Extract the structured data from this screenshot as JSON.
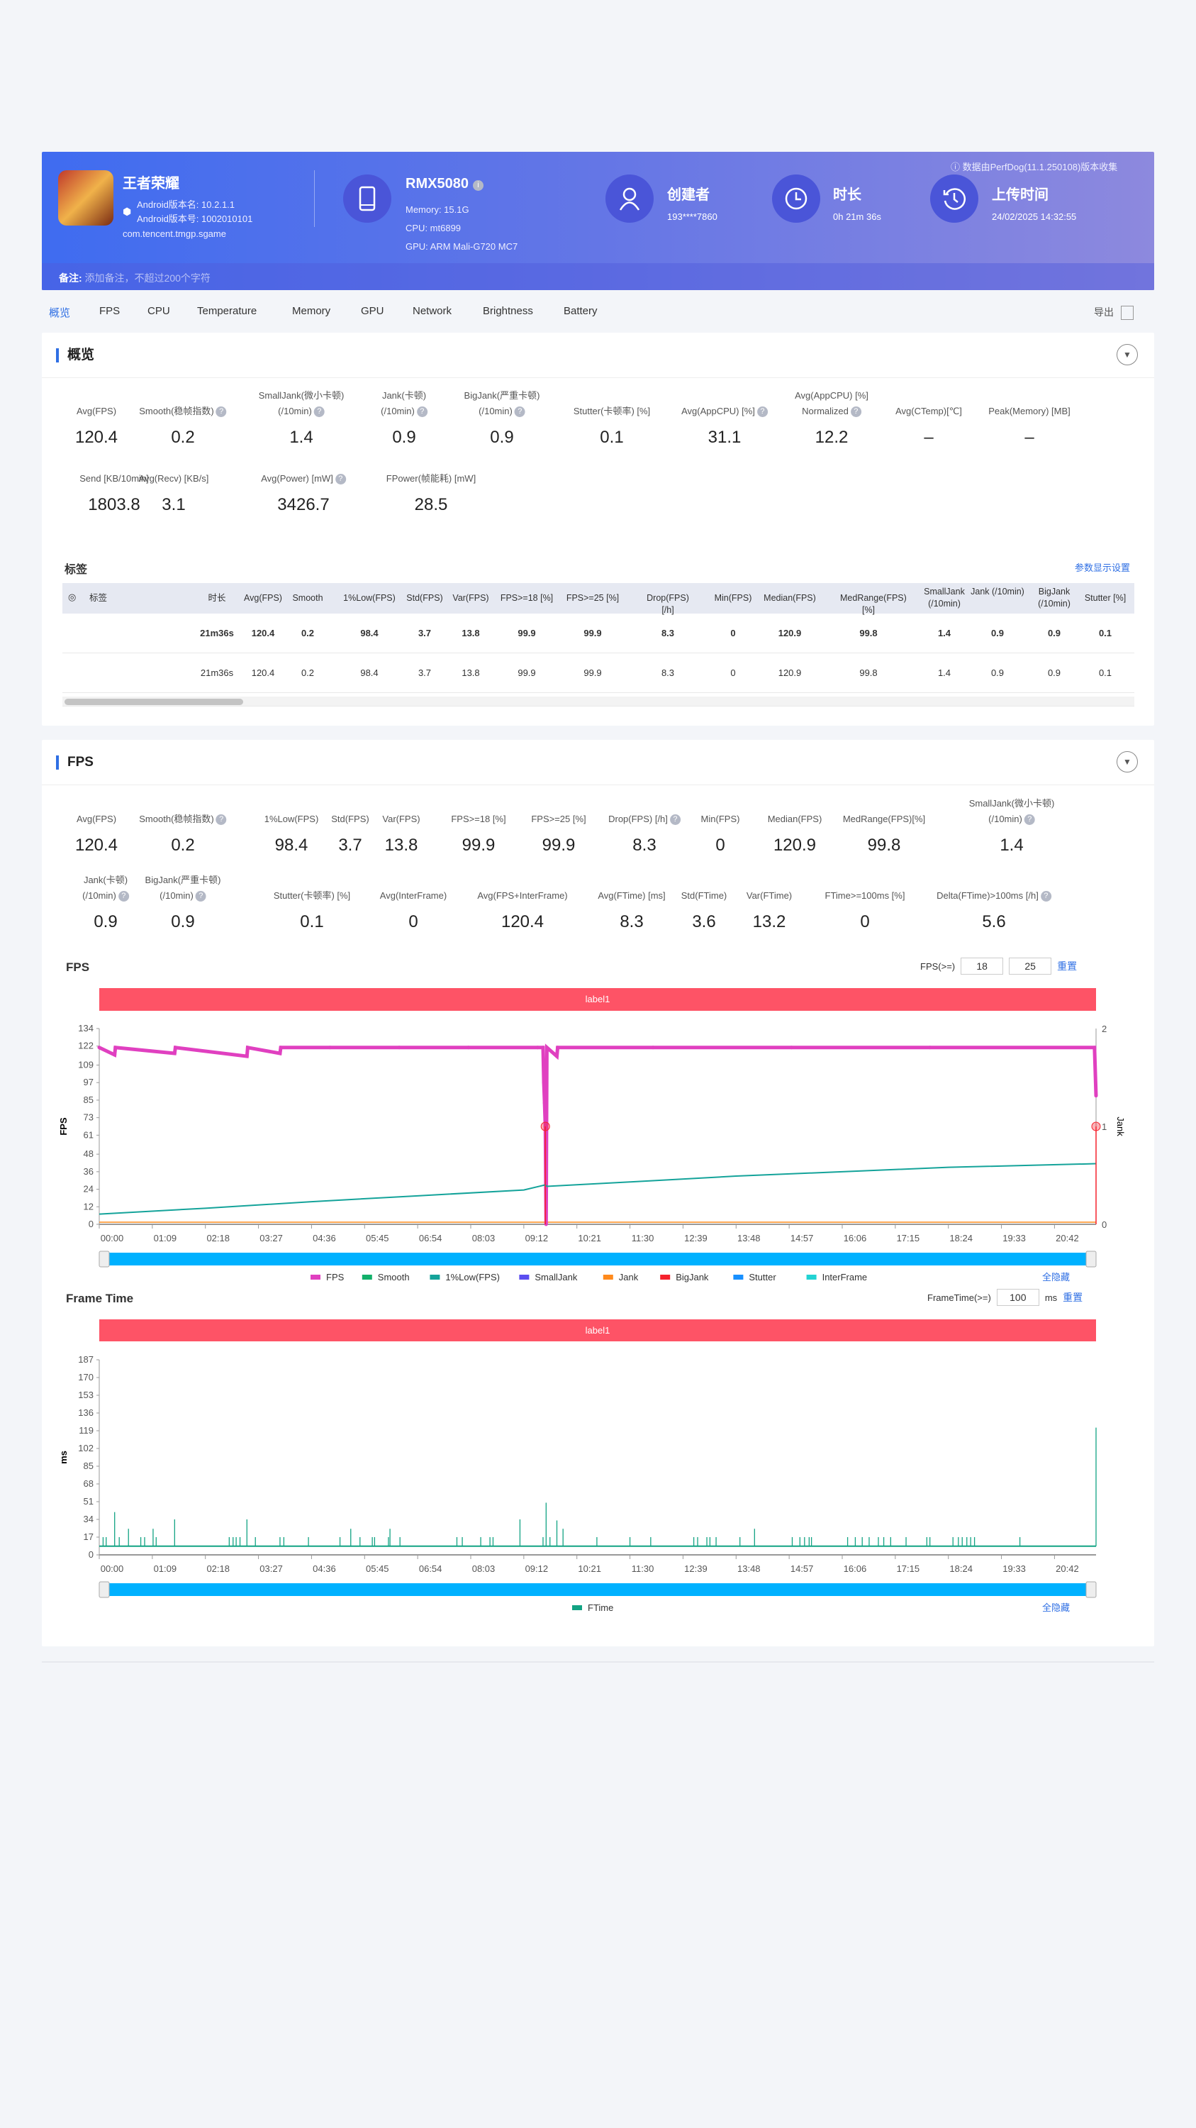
{
  "header": {
    "app_name": "王者荣耀",
    "android_version_name": "Android版本名: 10.2.1.1",
    "android_version_code": "Android版本号: 1002010101",
    "package": "com.tencent.tmgp.sgame",
    "device": "RMX5080",
    "memory": "Memory: 15.1G",
    "cpu": "CPU: mt6899",
    "gpu": "GPU: ARM Mali-G720 MC7",
    "creator_label": "创建者",
    "creator": "193****7860",
    "duration_label": "时长",
    "duration": "0h 21m 36s",
    "upload_label": "上传时间",
    "upload_time": "24/02/2025 14:32:55",
    "collected_by": "数据由PerfDog(11.1.250108)版本收集",
    "note_label": "备注:",
    "note_placeholder": "添加备注，不超过200个字符"
  },
  "tabs": [
    "概览",
    "FPS",
    "CPU",
    "Temperature",
    "Memory",
    "GPU",
    "Network",
    "Brightness",
    "Battery"
  ],
  "active_tab": 0,
  "export_label": "导出",
  "overview": {
    "title": "概览",
    "row1": [
      {
        "label": [
          "Avg(FPS)"
        ],
        "value": "120.4"
      },
      {
        "label": [
          "Smooth(稳帧指数)"
        ],
        "help": true,
        "value": "0.2"
      },
      {
        "label": [
          "SmallJank(微小卡顿)",
          "(/10min)"
        ],
        "help": true,
        "value": "1.4"
      },
      {
        "label": [
          "Jank(卡顿)",
          "(/10min)"
        ],
        "help": true,
        "value": "0.9"
      },
      {
        "label": [
          "BigJank(严重卡顿)",
          "(/10min)"
        ],
        "help": true,
        "value": "0.9"
      },
      {
        "label": [
          "Stutter(卡顿率) [%]"
        ],
        "value": "0.1"
      },
      {
        "label": [
          "Avg(AppCPU) [%]"
        ],
        "help": true,
        "value": "31.1"
      },
      {
        "label": [
          "Avg(AppCPU) [%]",
          "Normalized"
        ],
        "help": true,
        "value": "12.2"
      },
      {
        "label": [
          "Avg(CTemp)[℃]"
        ],
        "value": "–"
      },
      {
        "label": [
          "Peak(Memory) [MB]"
        ],
        "value": "–"
      }
    ],
    "row2": [
      {
        "label": [
          "Send [KB/10min]"
        ],
        "value": "1803.8"
      },
      {
        "label": [
          "Avg(Recv) [KB/s]"
        ],
        "value": "3.1"
      },
      {
        "label": [
          "Avg(Power) [mW]"
        ],
        "help": true,
        "value": "3426.7"
      },
      {
        "label": [
          "FPower(帧能耗) [mW]"
        ],
        "value": "28.5"
      }
    ],
    "tags_title": "标签",
    "param_settings": "参数显示设置",
    "table": {
      "columns": [
        "标签",
        "时长",
        "Avg(FPS)",
        "Smooth",
        "1%Low(FPS)",
        "Std(FPS)",
        "Var(FPS)",
        "FPS>=18 [%]",
        "FPS>=25 [%]",
        "Drop(FPS) [/h]",
        "Min(FPS)",
        "Median(FPS)",
        "MedRange(FPS)[%]",
        "SmallJank (/10min)",
        "Jank (/10min)",
        "BigJank (/10min)",
        "Stutter [%]"
      ],
      "rows": [
        [
          "",
          "21m36s",
          "120.4",
          "0.2",
          "98.4",
          "3.7",
          "13.8",
          "99.9",
          "99.9",
          "8.3",
          "0",
          "120.9",
          "99.8",
          "1.4",
          "0.9",
          "0.9",
          "0.1"
        ],
        [
          "",
          "21m36s",
          "120.4",
          "0.2",
          "98.4",
          "3.7",
          "13.8",
          "99.9",
          "99.9",
          "8.3",
          "0",
          "120.9",
          "99.8",
          "1.4",
          "0.9",
          "0.9",
          "0.1"
        ]
      ]
    }
  },
  "fps_section": {
    "title": "FPS",
    "row1": [
      {
        "label": [
          "Avg(FPS)"
        ],
        "value": "120.4"
      },
      {
        "label": [
          "Smooth(稳帧指数)"
        ],
        "help": true,
        "value": "0.2"
      },
      {
        "label": [
          "1%Low(FPS)"
        ],
        "value": "98.4"
      },
      {
        "label": [
          "Std(FPS)"
        ],
        "value": "3.7"
      },
      {
        "label": [
          "Var(FPS)"
        ],
        "value": "13.8"
      },
      {
        "label": [
          "FPS>=18 [%]"
        ],
        "value": "99.9"
      },
      {
        "label": [
          "FPS>=25 [%]"
        ],
        "value": "99.9"
      },
      {
        "label": [
          "Drop(FPS) [/h]"
        ],
        "help": true,
        "value": "8.3"
      },
      {
        "label": [
          "Min(FPS)"
        ],
        "value": "0"
      },
      {
        "label": [
          "Median(FPS)"
        ],
        "value": "120.9"
      },
      {
        "label": [
          "MedRange(FPS)[%]"
        ],
        "value": "99.8"
      },
      {
        "label": [
          "SmallJank(微小卡顿)",
          "(/10min)"
        ],
        "help": true,
        "value": "1.4"
      }
    ],
    "row2": [
      {
        "label": [
          "Jank(卡顿)",
          "(/10min)"
        ],
        "help": true,
        "value": "0.9"
      },
      {
        "label": [
          "BigJank(严重卡顿)",
          "(/10min)"
        ],
        "help": true,
        "value": "0.9"
      },
      {
        "label": [
          "Stutter(卡顿率) [%]"
        ],
        "value": "0.1"
      },
      {
        "label": [
          "Avg(InterFrame)"
        ],
        "value": "0"
      },
      {
        "label": [
          "Avg(FPS+InterFrame)"
        ],
        "value": "120.4"
      },
      {
        "label": [
          "Avg(FTime) [ms]"
        ],
        "value": "8.3"
      },
      {
        "label": [
          "Std(FTime)"
        ],
        "value": "3.6"
      },
      {
        "label": [
          "Var(FTime)"
        ],
        "value": "13.2"
      },
      {
        "label": [
          "FTime>=100ms [%]"
        ],
        "value": "0"
      },
      {
        "label": [
          "Delta(FTime)>100ms [/h]"
        ],
        "help": true,
        "value": "5.6"
      }
    ],
    "fps_threshold_label": "FPS(>=)",
    "fps_threshold_1": "18",
    "fps_threshold_2": "25",
    "reset": "重置",
    "ftime_threshold_label": "FrameTime(>=)",
    "ftime_threshold": "100",
    "ftime_unit": "ms",
    "hide_all": "全隐藏",
    "watermark": "PerfDog"
  },
  "chart_data": [
    {
      "type": "line",
      "title": "FPS",
      "label_band": "label1",
      "ylabel": "FPS",
      "y2label": "Jank",
      "ylim": [
        0,
        134
      ],
      "yticks": [
        0,
        12,
        24,
        36,
        48,
        61,
        73,
        85,
        97,
        109,
        122,
        134
      ],
      "y2lim": [
        0,
        2
      ],
      "y2ticks": [
        0,
        1,
        2
      ],
      "xlim": [
        "00:00",
        "21:36"
      ],
      "xticks": [
        "00:00",
        "01:09",
        "02:18",
        "03:27",
        "04:36",
        "05:45",
        "06:54",
        "08:03",
        "09:12",
        "10:21",
        "11:30",
        "12:39",
        "13:48",
        "14:57",
        "16:06",
        "17:15",
        "18:24",
        "19:33",
        "20:42"
      ],
      "legend": [
        {
          "name": "FPS",
          "color": "#e040c0"
        },
        {
          "name": "Smooth",
          "color": "#12b06a"
        },
        {
          "name": "1%Low(FPS)",
          "color": "#14a39a"
        },
        {
          "name": "SmallJank",
          "color": "#5b4ef0"
        },
        {
          "name": "Jank",
          "color": "#ff8a1c"
        },
        {
          "name": "BigJank",
          "color": "#f5222d"
        },
        {
          "name": "Stutter",
          "color": "#1890ff"
        },
        {
          "name": "InterFrame",
          "color": "#22d3d3"
        }
      ],
      "series": [
        {
          "name": "FPS",
          "points": [
            [
              "00:00",
              121
            ],
            [
              "00:20",
              116
            ],
            [
              "00:21",
              121
            ],
            [
              "01:38",
              117
            ],
            [
              "01:39",
              121
            ],
            [
              "03:12",
              115
            ],
            [
              "03:13",
              121
            ],
            [
              "03:55",
              117
            ],
            [
              "03:56",
              121
            ],
            [
              "05:00",
              121
            ],
            [
              "06:30",
              121
            ],
            [
              "08:00",
              121
            ],
            [
              "09:30",
              121
            ],
            [
              "09:37",
              121
            ],
            [
              "09:38",
              97
            ],
            [
              "09:39",
              83
            ],
            [
              "09:40",
              67
            ],
            [
              "09:41",
              0
            ],
            [
              "09:42",
              121
            ],
            [
              "09:55",
              115
            ],
            [
              "09:56",
              121
            ],
            [
              "12:00",
              121
            ],
            [
              "15:00",
              121
            ],
            [
              "18:00",
              121
            ],
            [
              "21:34",
              121
            ],
            [
              "21:36",
              88
            ]
          ]
        },
        {
          "name": "1%Low(FPS)",
          "points": [
            [
              "00:00",
              7
            ],
            [
              "02:18",
              11
            ],
            [
              "04:36",
              15.5
            ],
            [
              "06:54",
              19.5
            ],
            [
              "09:12",
              23.5
            ],
            [
              "09:40",
              27
            ],
            [
              "09:42",
              26
            ],
            [
              "11:30",
              29
            ],
            [
              "13:48",
              33
            ],
            [
              "16:06",
              36
            ],
            [
              "18:24",
              39
            ],
            [
              "21:36",
              41.5
            ]
          ]
        },
        {
          "name": "BigJank",
          "axis": "right",
          "points": [
            [
              "09:40",
              1
            ],
            [
              "21:36",
              1
            ]
          ]
        }
      ]
    },
    {
      "type": "line",
      "title": "Frame Time",
      "label_band": "label1",
      "ylabel": "ms",
      "ylim": [
        0,
        187
      ],
      "yticks": [
        0,
        17,
        34,
        51,
        68,
        85,
        102,
        119,
        136,
        153,
        170,
        187
      ],
      "xlim": [
        "00:00",
        "21:36"
      ],
      "xticks": [
        "00:00",
        "01:09",
        "02:18",
        "03:27",
        "04:36",
        "05:45",
        "06:54",
        "08:03",
        "09:12",
        "10:21",
        "11:30",
        "12:39",
        "13:48",
        "14:57",
        "16:06",
        "17:15",
        "18:24",
        "19:33",
        "20:42"
      ],
      "legend": [
        {
          "name": "FTime",
          "color": "#12a383"
        }
      ],
      "series": [
        {
          "name": "FTime",
          "baseline": 8.3,
          "spikes": [
            [
              "00:05",
              17
            ],
            [
              "00:09",
              17
            ],
            [
              "00:20",
              41
            ],
            [
              "00:26",
              17
            ],
            [
              "00:38",
              25
            ],
            [
              "00:54",
              17
            ],
            [
              "00:59",
              17
            ],
            [
              "01:10",
              25
            ],
            [
              "01:14",
              17
            ],
            [
              "01:38",
              34
            ],
            [
              "02:49",
              17
            ],
            [
              "02:54",
              17
            ],
            [
              "02:58",
              17
            ],
            [
              "03:03",
              17
            ],
            [
              "03:12",
              34
            ],
            [
              "03:23",
              17
            ],
            [
              "03:55",
              17
            ],
            [
              "04:00",
              17
            ],
            [
              "04:32",
              17
            ],
            [
              "05:13",
              17
            ],
            [
              "05:27",
              25
            ],
            [
              "05:39",
              17
            ],
            [
              "05:55",
              17
            ],
            [
              "05:58",
              17
            ],
            [
              "06:16",
              17
            ],
            [
              "06:18",
              25
            ],
            [
              "06:31",
              17
            ],
            [
              "07:45",
              17
            ],
            [
              "07:52",
              17
            ],
            [
              "08:16",
              17
            ],
            [
              "08:28",
              17
            ],
            [
              "08:32",
              17
            ],
            [
              "09:07",
              34
            ],
            [
              "09:37",
              17
            ],
            [
              "09:41",
              50
            ],
            [
              "09:46",
              17
            ],
            [
              "09:55",
              33
            ],
            [
              "10:03",
              25
            ],
            [
              "10:47",
              17
            ],
            [
              "11:30",
              17
            ],
            [
              "11:57",
              17
            ],
            [
              "12:53",
              17
            ],
            [
              "12:58",
              17
            ],
            [
              "13:10",
              17
            ],
            [
              "13:14",
              17
            ],
            [
              "13:22",
              17
            ],
            [
              "13:53",
              17
            ],
            [
              "14:12",
              25
            ],
            [
              "15:01",
              17
            ],
            [
              "15:11",
              17
            ],
            [
              "15:17",
              17
            ],
            [
              "15:23",
              17
            ],
            [
              "15:26",
              17
            ],
            [
              "16:13",
              17
            ],
            [
              "16:23",
              17
            ],
            [
              "16:32",
              17
            ],
            [
              "16:41",
              17
            ],
            [
              "16:53",
              17
            ],
            [
              "17:00",
              17
            ],
            [
              "17:09",
              17
            ],
            [
              "17:29",
              17
            ],
            [
              "17:56",
              17
            ],
            [
              "18:00",
              17
            ],
            [
              "18:30",
              17
            ],
            [
              "18:37",
              17
            ],
            [
              "18:42",
              17
            ],
            [
              "18:48",
              17
            ],
            [
              "18:53",
              17
            ],
            [
              "18:58",
              17
            ],
            [
              "19:57",
              17
            ],
            [
              "21:36",
              122
            ]
          ]
        }
      ]
    }
  ]
}
